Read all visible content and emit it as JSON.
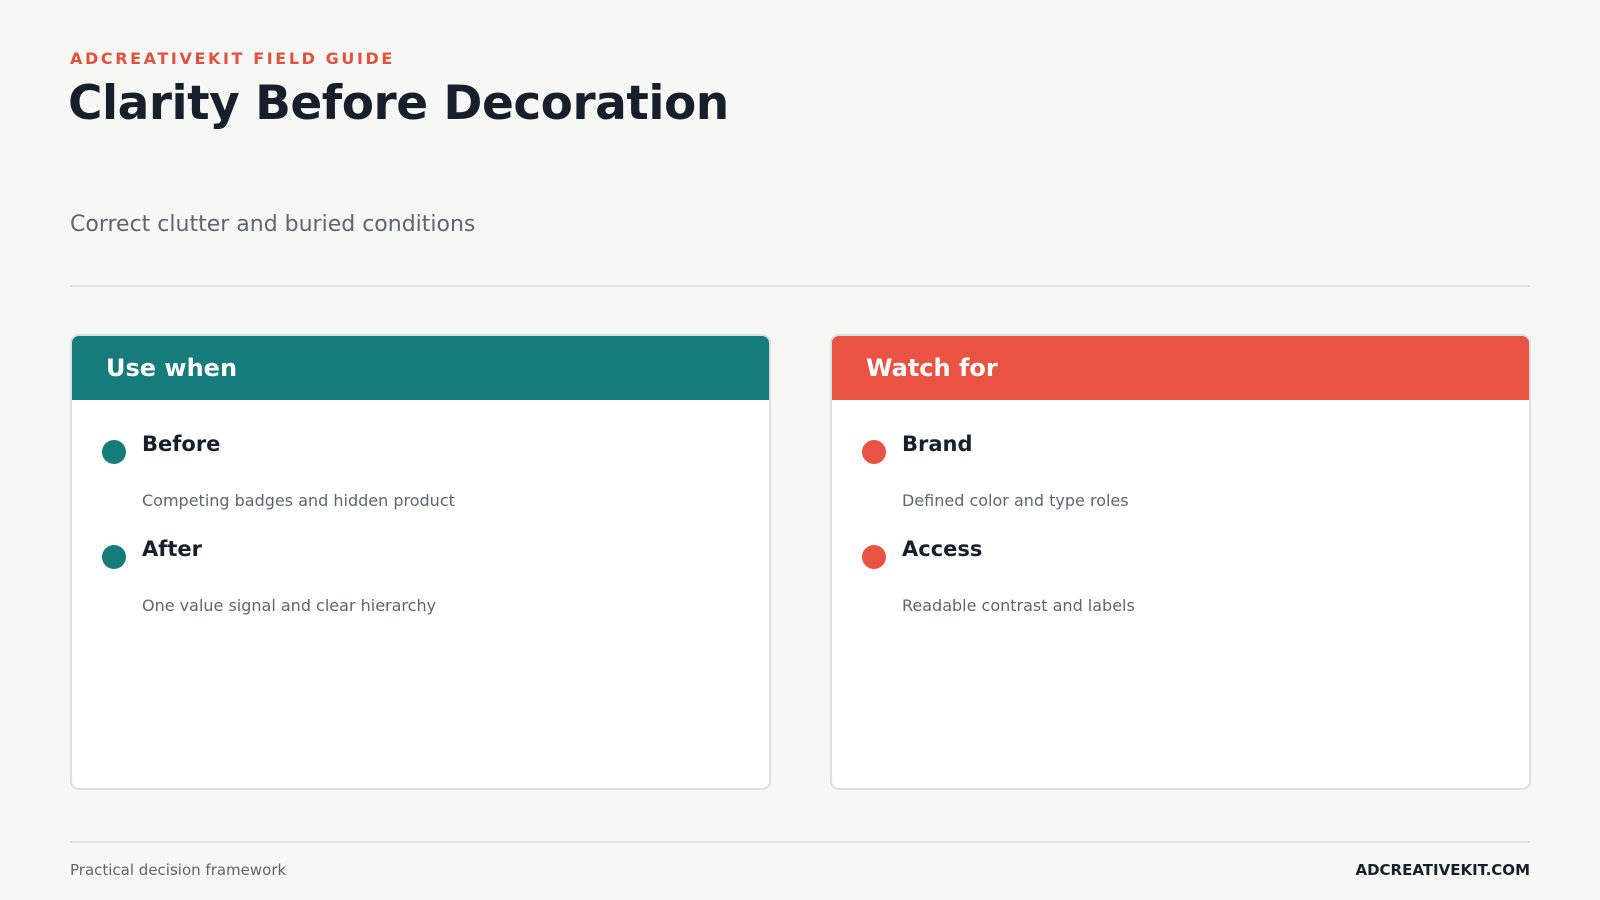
{
  "header": {
    "eyebrow": "ADCREATIVEKIT FIELD GUIDE",
    "title": "Clarity Before Decoration",
    "subtitle": "Correct clutter and buried conditions"
  },
  "colors": {
    "use_when": "#157b7b",
    "watch_for": "#e85343",
    "eyebrow": "#e0523f"
  },
  "cards": [
    {
      "heading": "Use when",
      "items": [
        {
          "title": "Before",
          "description": "Competing badges and hidden product"
        },
        {
          "title": "After",
          "description": "One value signal and clear hierarchy"
        }
      ]
    },
    {
      "heading": "Watch for",
      "items": [
        {
          "title": "Brand",
          "description": "Defined color and type roles"
        },
        {
          "title": "Access",
          "description": "Readable contrast and labels"
        }
      ]
    }
  ],
  "footer": {
    "left": "Practical decision framework",
    "right": "ADCREATIVEKIT.COM"
  }
}
